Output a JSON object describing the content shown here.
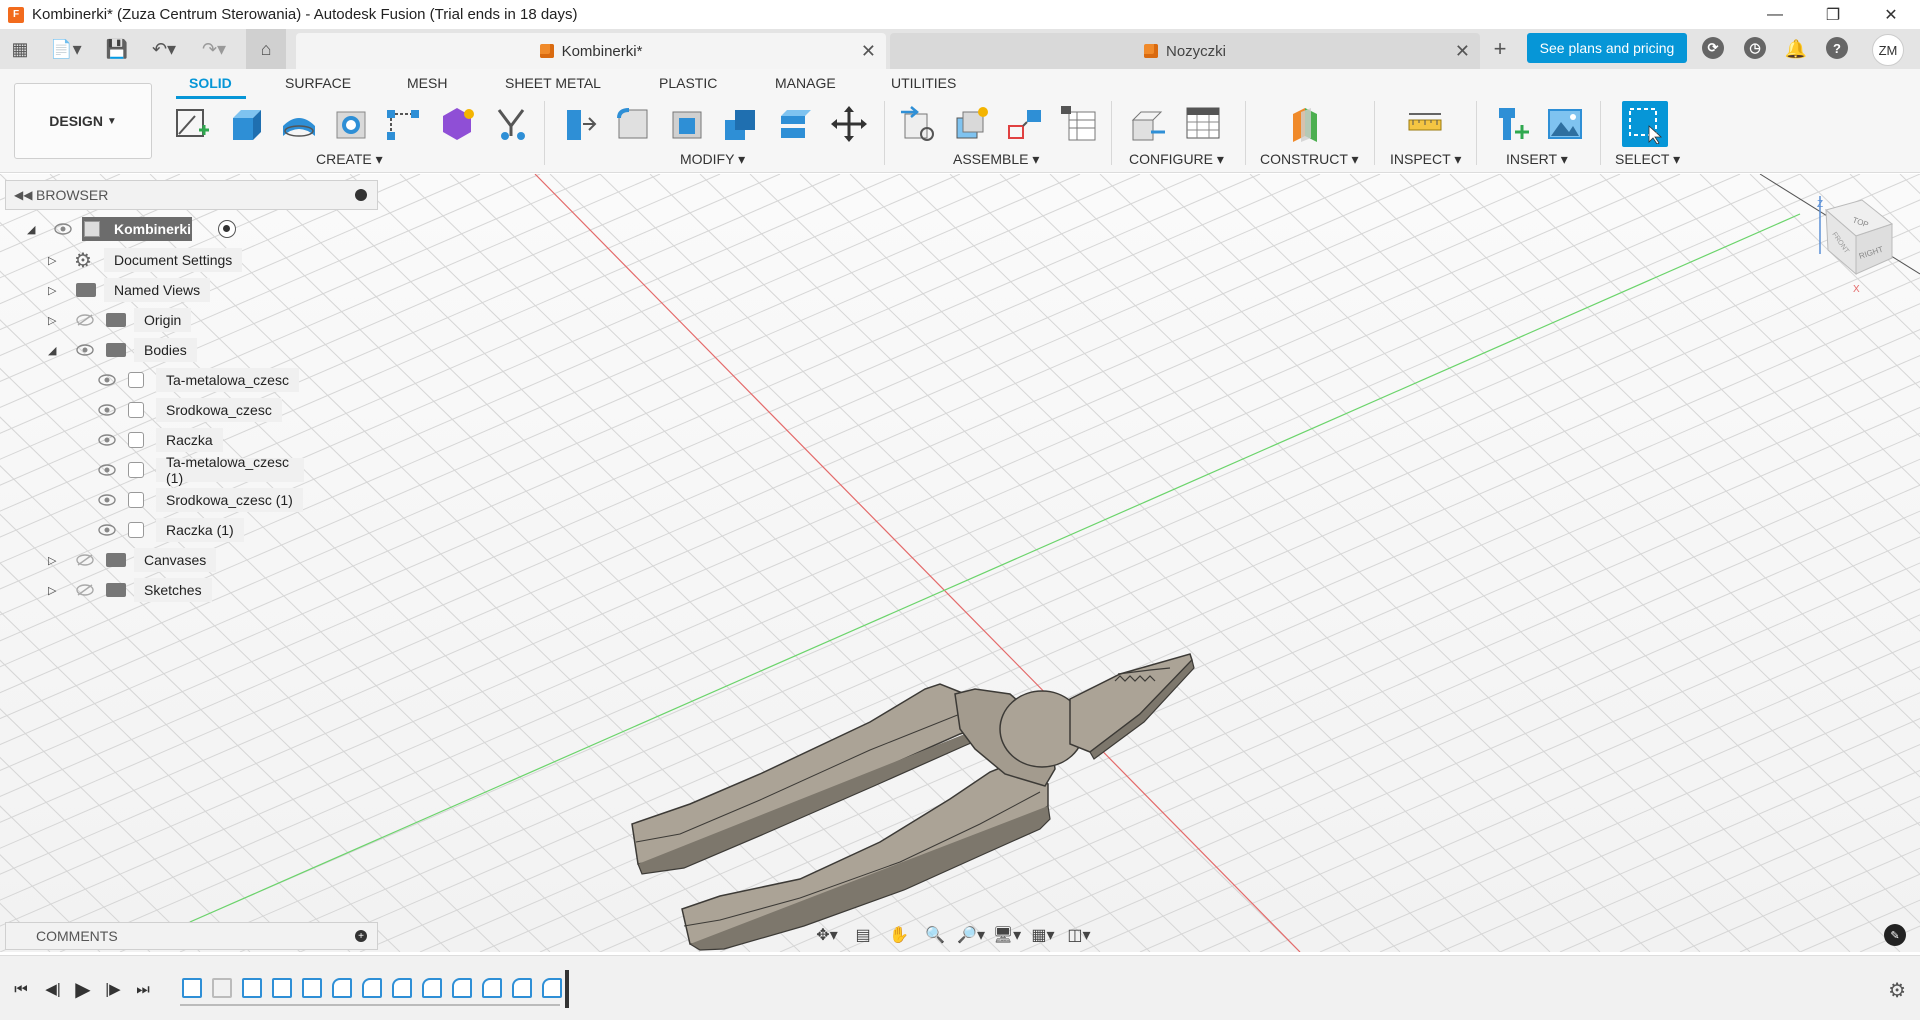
{
  "window": {
    "title": "Kombinerki* (Zuza Centrum Sterowania) - Autodesk Fusion (Trial ends in 18 days)",
    "controls": [
      "minimize",
      "restore",
      "close"
    ]
  },
  "tabs": {
    "active": "Kombinerki*",
    "inactive": "Nozyczki",
    "plans_button": "See plans and pricing",
    "user_initials": "ZM"
  },
  "toolbar": {
    "workspace": "DESIGN",
    "tabs": [
      "SOLID",
      "SURFACE",
      "MESH",
      "SHEET METAL",
      "PLASTIC",
      "MANAGE",
      "UTILITIES"
    ],
    "active_tab": "SOLID",
    "groups": [
      "CREATE",
      "MODIFY",
      "ASSEMBLE",
      "CONFIGURE",
      "CONSTRUCT",
      "INSPECT",
      "INSERT",
      "SELECT"
    ],
    "dropdown_marker": "▾",
    "accent": "#0696d7"
  },
  "browser": {
    "title": "BROWSER",
    "root": "Kombinerki",
    "items": [
      {
        "label": "Document Settings",
        "icon": "gear-icon"
      },
      {
        "label": "Named Views",
        "icon": "folder-icon"
      },
      {
        "label": "Origin",
        "icon": "folder-icon"
      },
      {
        "label": "Bodies",
        "icon": "folder-icon"
      }
    ],
    "bodies": [
      "Ta-metalowa_czesc",
      "Srodkowa_czesc",
      "Raczka",
      "Ta-metalowa_czesc (1)",
      "Srodkowa_czesc (1)",
      "Raczka (1)"
    ],
    "after": [
      {
        "label": "Canvases",
        "icon": "folder-icon"
      },
      {
        "label": "Sketches",
        "icon": "folder-icon"
      }
    ]
  },
  "comments": {
    "title": "COMMENTS"
  },
  "viewcube": {
    "top": "TOP",
    "right": "RIGHT",
    "front": "FRONT"
  },
  "colors": {
    "model": "#aba396",
    "model_edge": "#3c3a36",
    "x_axis": "#e46a6a",
    "y_axis": "#6bd46b"
  }
}
